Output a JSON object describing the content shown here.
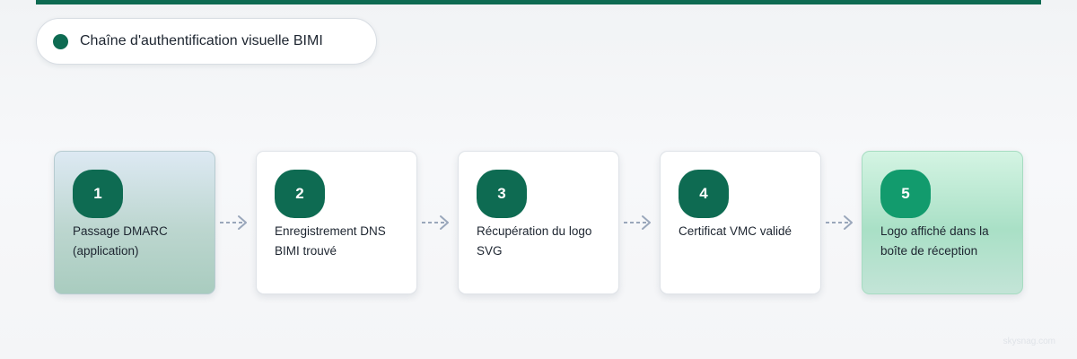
{
  "header": {
    "title": "Chaîne d'authentification visuelle BIMI"
  },
  "steps": [
    {
      "number": "1",
      "label": "Passage DMARC (application)"
    },
    {
      "number": "2",
      "label": "Enregistrement DNS BIMI trouvé"
    },
    {
      "number": "3",
      "label": "Récupération du logo SVG"
    },
    {
      "number": "4",
      "label": "Certificat VMC validé"
    },
    {
      "number": "5",
      "label": "Logo affiché dans la boîte de réception"
    }
  ],
  "watermark": "skysnag.com",
  "colors": {
    "brand": "#0e6b52",
    "accent": "#129b6d",
    "arrow": "#9aa7bb"
  },
  "icons": {
    "connector": "dashed-arrow-right-icon",
    "title_marker": "status-dot-icon"
  }
}
